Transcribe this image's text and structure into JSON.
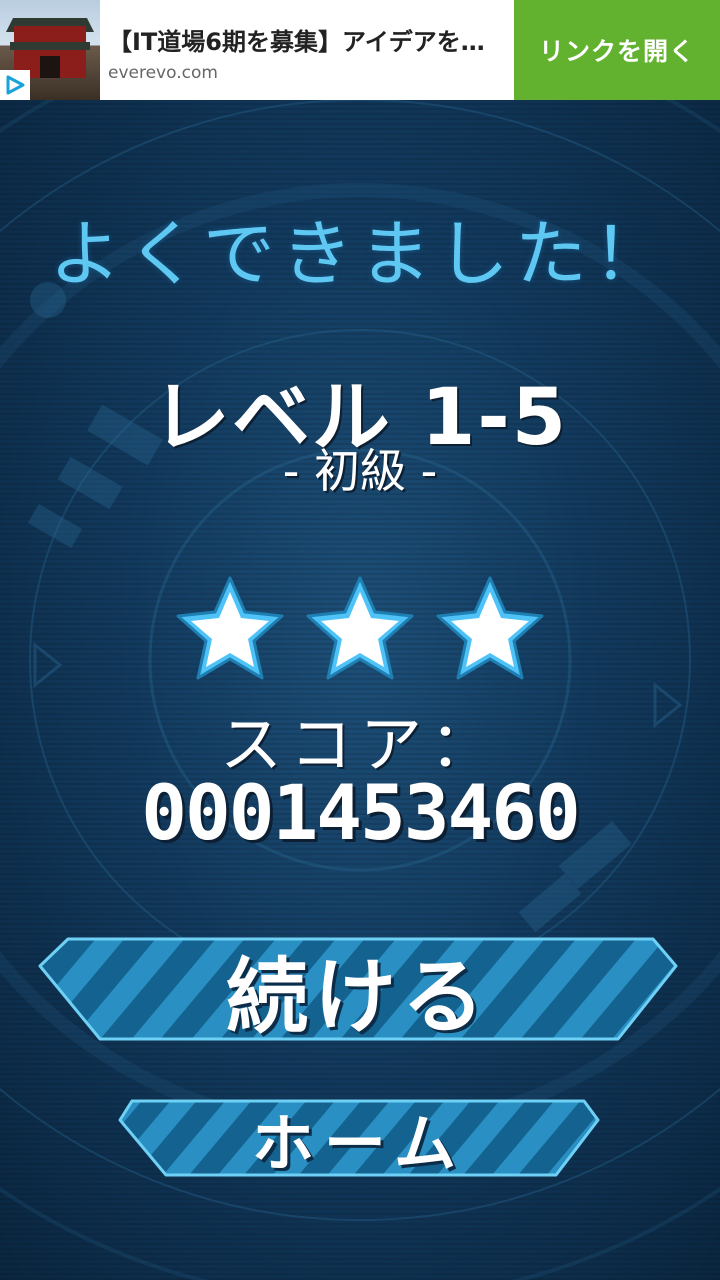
{
  "ad": {
    "title": "【IT道場6期を募集】アイデアを…",
    "domain": "everevo.com",
    "cta": "リンクを開く",
    "play_icon": "ad-play-icon"
  },
  "result": {
    "headline": "よくできました！",
    "level": "レベル 1-5",
    "difficulty": "- 初級 -",
    "stars_earned": 3,
    "stars_total": 3,
    "score_label": "スコア：",
    "score_value": "0001453460"
  },
  "buttons": {
    "continue_label": "続ける",
    "home_label": "ホーム"
  },
  "colors": {
    "headline": "#5ec8f2",
    "ad_cta": "#62b22f",
    "star_fill": "#ffffff",
    "star_outline": "#4fc3f7",
    "button_stripe_dark": "#13628f",
    "button_stripe_light": "#2a8fc2"
  }
}
